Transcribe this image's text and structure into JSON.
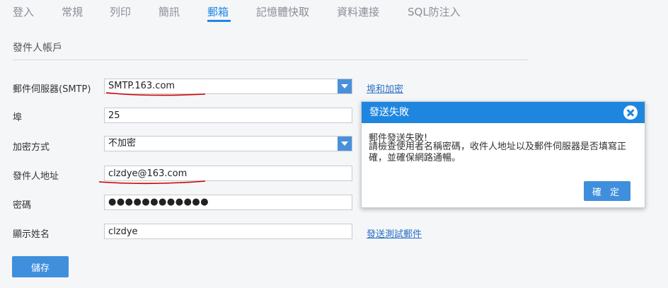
{
  "tabs": [
    {
      "label": "登入"
    },
    {
      "label": "常規"
    },
    {
      "label": "列印"
    },
    {
      "label": "簡訊"
    },
    {
      "label": "郵箱"
    },
    {
      "label": "記憶體快取"
    },
    {
      "label": "資料連接"
    },
    {
      "label": "SQL防注入"
    }
  ],
  "active_tab": "郵箱",
  "section_title": "發件人帳戶",
  "form": {
    "smtp_label": "郵件伺服器(SMTP)",
    "smtp_value": "SMTP.163.com",
    "port_label": "埠",
    "port_value": "25",
    "encryption_label": "加密方式",
    "encryption_value": "不加密",
    "sender_label": "發件人地址",
    "sender_value": "clzdye@163.com",
    "password_label": "密碼",
    "password_value": "●●●●●●●●●●●●",
    "display_name_label": "顯示姓名",
    "display_name_value": "clzdye"
  },
  "links": {
    "port_encryption": "埠和加密",
    "send_test": "發送測試郵件"
  },
  "save_label": "儲存",
  "dialog": {
    "title": "發送失敗",
    "message_title": "郵件發送失敗!",
    "message": "請檢查使用者名稱密碼，收件人地址以及郵件伺服器是否填寫正確，並確保網路通暢。",
    "ok_label": "確 定"
  },
  "colors": {
    "accent": "#1e88e5",
    "annotation": "#cc0000"
  }
}
